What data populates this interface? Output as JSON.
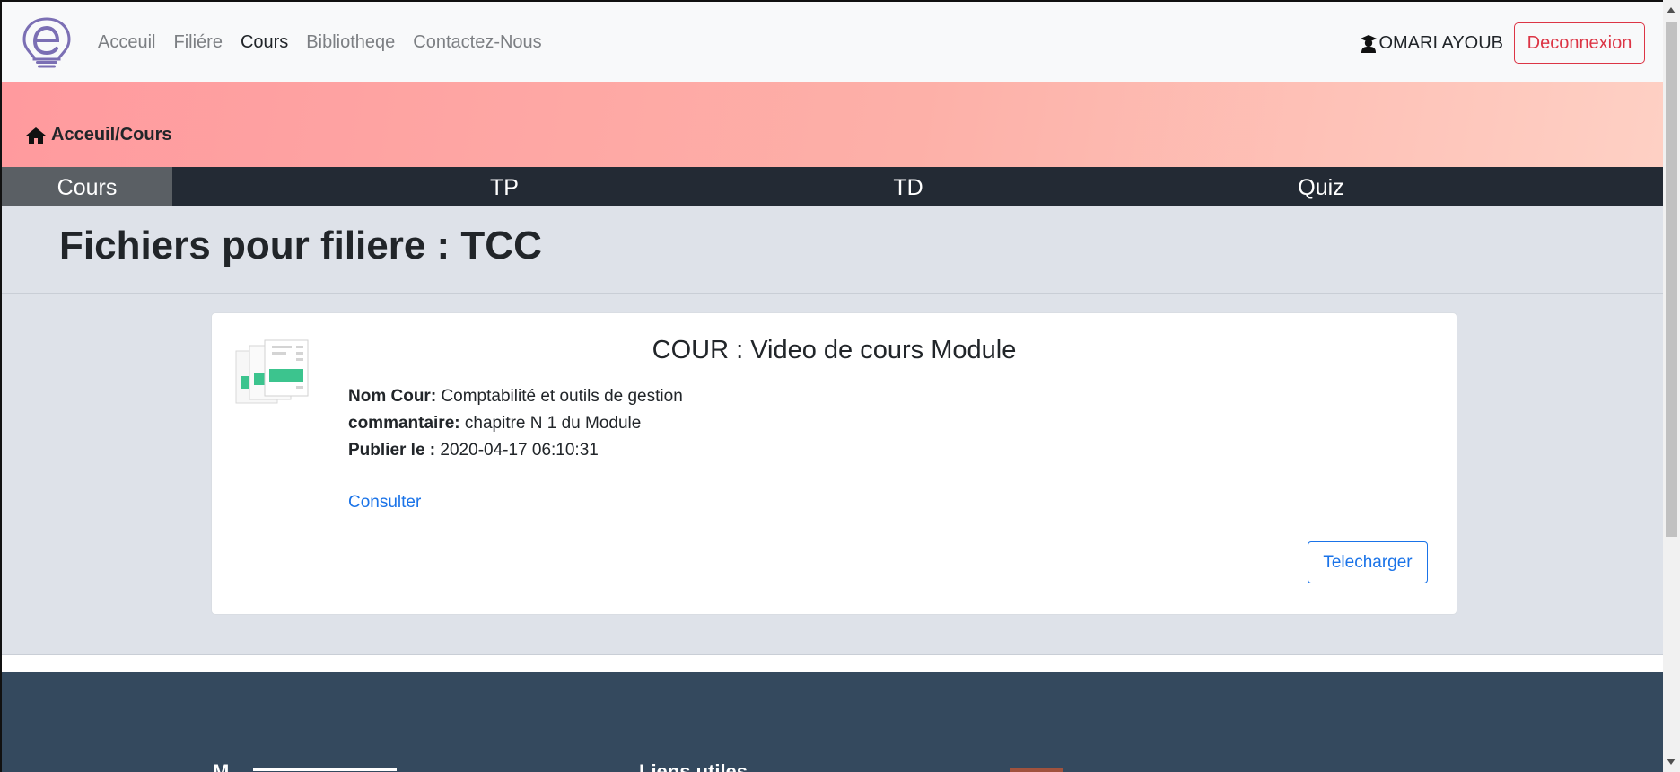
{
  "navbar": {
    "links": [
      "Acceuil",
      "Filiére",
      "Cours",
      "Bibliotheqe",
      "Contactez-Nous"
    ],
    "user_name": "OMARI AYOUB",
    "logout_label": "Deconnexion"
  },
  "banner": {
    "breadcrumb": "Acceuil/Cours"
  },
  "tabs": [
    "Cours",
    "TP",
    "TD",
    "Quiz"
  ],
  "main": {
    "title": "Fichiers pour filiere : TCC",
    "card": {
      "title": "COUR : Video de cours Module",
      "nom_label": "Nom Cour:",
      "nom_value": "Comptabilité et outils de gestion",
      "commentaire_label": "commantaire:",
      "commentaire_value": "chapitre N 1 du Module",
      "publie_label": "Publier le :",
      "publie_value": "2020-04-17 06:10:31",
      "consult_label": "Consulter",
      "download_label": "Telecharger"
    }
  },
  "footer": {
    "heading_1": "M",
    "heading_2": "Liens utiles"
  },
  "colors": {
    "danger": "#dc3545",
    "primary": "#1a73e8",
    "tabs_bg": "#232a34",
    "footer_bg": "#34495e",
    "banner_gradient": [
      "#ff9a9e",
      "#fed0c4"
    ]
  },
  "icons": [
    "lightbulb-logo-icon",
    "user-graduate-icon",
    "home-icon",
    "files-icon"
  ]
}
